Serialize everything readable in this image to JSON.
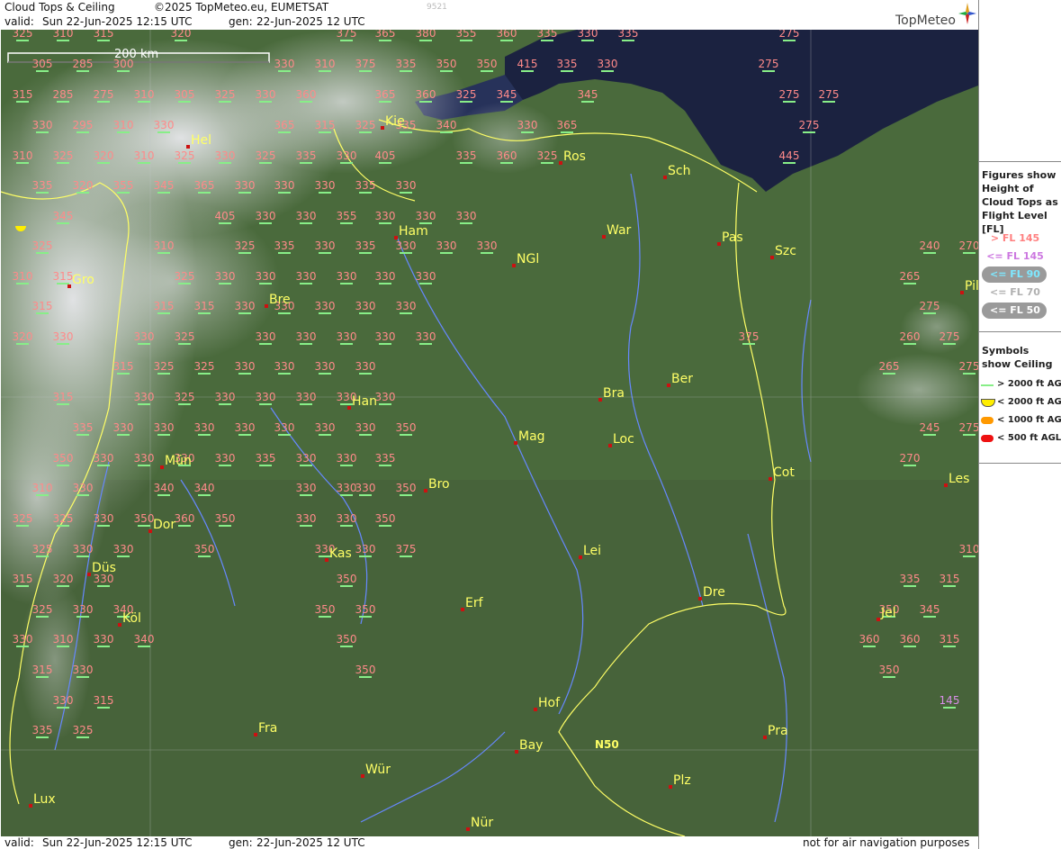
{
  "header": {
    "title": "Cloud Tops & Ceiling",
    "copyright": "©2025 TopMeteo.eu, EUMETSAT",
    "valid_label": "valid:",
    "valid_time": "Sun  22-Jun-2025  12:15 UTC",
    "gen_label": "gen:",
    "gen_time": "22-Jun-2025 12 UTC",
    "code": "9521",
    "logo_text": "TopMeteo"
  },
  "footer": {
    "valid_label": "valid:",
    "valid_time": "Sun  22-Jun-2025  12:15 UTC",
    "gen_label": "gen:",
    "gen_time": "22-Jun-2025 12 UTC",
    "disclaimer": "not for air navigation purposes"
  },
  "map": {
    "scale_label": "200 km",
    "grid_label": "N50",
    "colors": {
      "tops_high": "#ff8a8a",
      "tops_mid": "#d88ee8",
      "tops_low": "#7ee8ff",
      "city": "#ffff66",
      "city_marker": "#cc1111",
      "ceiling_gt2000": "#88ee88",
      "ceiling_lt2000": "#ffee00",
      "sea": "#1b2240",
      "land": "#4a6a3c",
      "border": "#ffff66",
      "river": "#6688ff"
    },
    "cities": [
      {
        "name": "Hel"
      },
      {
        "name": "Kie"
      },
      {
        "name": "Ros"
      },
      {
        "name": "Sch"
      },
      {
        "name": "Ham"
      },
      {
        "name": "War"
      },
      {
        "name": "Pas"
      },
      {
        "name": "Szc"
      },
      {
        "name": "NGl"
      },
      {
        "name": "Gro"
      },
      {
        "name": "Bre"
      },
      {
        "name": "Pil"
      },
      {
        "name": "Ber"
      },
      {
        "name": "Bra"
      },
      {
        "name": "Han"
      },
      {
        "name": "Mag"
      },
      {
        "name": "Loc"
      },
      {
        "name": "Mün"
      },
      {
        "name": "Cot"
      },
      {
        "name": "Les"
      },
      {
        "name": "Bro"
      },
      {
        "name": "Dor"
      },
      {
        "name": "Kas"
      },
      {
        "name": "Lei"
      },
      {
        "name": "Düs"
      },
      {
        "name": "Dre"
      },
      {
        "name": "Erf"
      },
      {
        "name": "Köl"
      },
      {
        "name": "Jel"
      },
      {
        "name": "Hof"
      },
      {
        "name": "Fra"
      },
      {
        "name": "Pra"
      },
      {
        "name": "Bay"
      },
      {
        "name": "Wür"
      },
      {
        "name": "Plz"
      },
      {
        "name": "Lux"
      },
      {
        "name": "Nür"
      }
    ],
    "tops": [
      {
        "v": "325",
        "c": "high"
      },
      {
        "v": "310",
        "c": "high"
      },
      {
        "v": "315",
        "c": "high"
      },
      {
        "v": "320",
        "c": "high"
      },
      {
        "v": "375",
        "c": "high"
      },
      {
        "v": "365",
        "c": "high"
      },
      {
        "v": "380",
        "c": "high"
      },
      {
        "v": "355",
        "c": "high"
      },
      {
        "v": "360",
        "c": "high"
      },
      {
        "v": "335",
        "c": "high"
      },
      {
        "v": "330",
        "c": "high"
      },
      {
        "v": "335",
        "c": "high"
      },
      {
        "v": "275",
        "c": "high"
      },
      {
        "v": "305",
        "c": "high"
      },
      {
        "v": "285",
        "c": "high"
      },
      {
        "v": "300",
        "c": "high"
      },
      {
        "v": "330",
        "c": "high"
      },
      {
        "v": "310",
        "c": "high"
      },
      {
        "v": "375",
        "c": "high"
      },
      {
        "v": "335",
        "c": "high"
      },
      {
        "v": "350",
        "c": "high"
      },
      {
        "v": "350",
        "c": "high"
      },
      {
        "v": "415",
        "c": "high"
      },
      {
        "v": "335",
        "c": "high"
      },
      {
        "v": "330",
        "c": "high"
      },
      {
        "v": "275",
        "c": "high"
      },
      {
        "v": "315",
        "c": "high"
      },
      {
        "v": "285",
        "c": "high"
      },
      {
        "v": "275",
        "c": "high"
      },
      {
        "v": "310",
        "c": "high"
      },
      {
        "v": "305",
        "c": "high"
      },
      {
        "v": "325",
        "c": "high"
      },
      {
        "v": "330",
        "c": "high"
      },
      {
        "v": "360",
        "c": "high"
      },
      {
        "v": "365",
        "c": "high"
      },
      {
        "v": "360",
        "c": "high"
      },
      {
        "v": "325",
        "c": "high"
      },
      {
        "v": "345",
        "c": "high"
      },
      {
        "v": "345",
        "c": "high"
      },
      {
        "v": "275",
        "c": "high"
      },
      {
        "v": "275",
        "c": "high"
      },
      {
        "v": "330",
        "c": "high"
      },
      {
        "v": "295",
        "c": "high"
      },
      {
        "v": "310",
        "c": "high"
      },
      {
        "v": "330",
        "c": "high"
      },
      {
        "v": "365",
        "c": "high"
      },
      {
        "v": "315",
        "c": "high"
      },
      {
        "v": "325",
        "c": "high"
      },
      {
        "v": "335",
        "c": "high"
      },
      {
        "v": "340",
        "c": "high"
      },
      {
        "v": "330",
        "c": "high"
      },
      {
        "v": "365",
        "c": "high"
      },
      {
        "v": "275",
        "c": "high"
      },
      {
        "v": "310",
        "c": "high"
      },
      {
        "v": "325",
        "c": "high"
      },
      {
        "v": "320",
        "c": "high"
      },
      {
        "v": "310",
        "c": "high"
      },
      {
        "v": "325",
        "c": "high"
      },
      {
        "v": "330",
        "c": "high"
      },
      {
        "v": "325",
        "c": "high"
      },
      {
        "v": "335",
        "c": "high"
      },
      {
        "v": "330",
        "c": "high"
      },
      {
        "v": "405",
        "c": "high"
      },
      {
        "v": "335",
        "c": "high"
      },
      {
        "v": "360",
        "c": "high"
      },
      {
        "v": "325",
        "c": "high"
      },
      {
        "v": "445",
        "c": "high"
      },
      {
        "v": "335",
        "c": "high"
      },
      {
        "v": "320",
        "c": "high"
      },
      {
        "v": "355",
        "c": "high"
      },
      {
        "v": "345",
        "c": "high"
      },
      {
        "v": "365",
        "c": "high"
      },
      {
        "v": "330",
        "c": "high"
      },
      {
        "v": "330",
        "c": "high"
      },
      {
        "v": "330",
        "c": "high"
      },
      {
        "v": "335",
        "c": "high"
      },
      {
        "v": "330",
        "c": "high"
      },
      {
        "v": "345",
        "c": "high"
      },
      {
        "v": "405",
        "c": "high"
      },
      {
        "v": "330",
        "c": "high"
      },
      {
        "v": "330",
        "c": "high"
      },
      {
        "v": "355",
        "c": "high"
      },
      {
        "v": "330",
        "c": "high"
      },
      {
        "v": "330",
        "c": "high"
      },
      {
        "v": "330",
        "c": "high"
      },
      {
        "v": "325",
        "c": "high"
      },
      {
        "v": "310",
        "c": "high"
      },
      {
        "v": "325",
        "c": "high"
      },
      {
        "v": "335",
        "c": "high"
      },
      {
        "v": "330",
        "c": "high"
      },
      {
        "v": "335",
        "c": "high"
      },
      {
        "v": "330",
        "c": "high"
      },
      {
        "v": "330",
        "c": "high"
      },
      {
        "v": "330",
        "c": "high"
      },
      {
        "v": "240",
        "c": "high"
      },
      {
        "v": "270",
        "c": "high"
      },
      {
        "v": "310",
        "c": "high"
      },
      {
        "v": "315",
        "c": "high"
      },
      {
        "v": "325",
        "c": "high"
      },
      {
        "v": "330",
        "c": "high"
      },
      {
        "v": "330",
        "c": "high"
      },
      {
        "v": "330",
        "c": "high"
      },
      {
        "v": "330",
        "c": "high"
      },
      {
        "v": "330",
        "c": "high"
      },
      {
        "v": "330",
        "c": "high"
      },
      {
        "v": "265",
        "c": "high"
      },
      {
        "v": "315",
        "c": "high"
      },
      {
        "v": "315",
        "c": "high"
      },
      {
        "v": "315",
        "c": "high"
      },
      {
        "v": "330",
        "c": "high"
      },
      {
        "v": "330",
        "c": "high"
      },
      {
        "v": "330",
        "c": "high"
      },
      {
        "v": "330",
        "c": "high"
      },
      {
        "v": "330",
        "c": "high"
      },
      {
        "v": "275",
        "c": "high"
      },
      {
        "v": "320",
        "c": "high"
      },
      {
        "v": "330",
        "c": "high"
      },
      {
        "v": "330",
        "c": "high"
      },
      {
        "v": "325",
        "c": "high"
      },
      {
        "v": "330",
        "c": "high"
      },
      {
        "v": "330",
        "c": "high"
      },
      {
        "v": "330",
        "c": "high"
      },
      {
        "v": "330",
        "c": "high"
      },
      {
        "v": "330",
        "c": "high"
      },
      {
        "v": "375",
        "c": "high"
      },
      {
        "v": "260",
        "c": "high"
      },
      {
        "v": "275",
        "c": "high"
      },
      {
        "v": "315",
        "c": "high"
      },
      {
        "v": "325",
        "c": "high"
      },
      {
        "v": "325",
        "c": "high"
      },
      {
        "v": "330",
        "c": "high"
      },
      {
        "v": "330",
        "c": "high"
      },
      {
        "v": "330",
        "c": "high"
      },
      {
        "v": "330",
        "c": "high"
      },
      {
        "v": "265",
        "c": "high"
      },
      {
        "v": "275",
        "c": "high"
      },
      {
        "v": "315",
        "c": "high"
      },
      {
        "v": "330",
        "c": "high"
      },
      {
        "v": "325",
        "c": "high"
      },
      {
        "v": "330",
        "c": "high"
      },
      {
        "v": "330",
        "c": "high"
      },
      {
        "v": "330",
        "c": "high"
      },
      {
        "v": "330",
        "c": "high"
      },
      {
        "v": "330",
        "c": "high"
      },
      {
        "v": "335",
        "c": "high"
      },
      {
        "v": "330",
        "c": "high"
      },
      {
        "v": "330",
        "c": "high"
      },
      {
        "v": "330",
        "c": "high"
      },
      {
        "v": "330",
        "c": "high"
      },
      {
        "v": "330",
        "c": "high"
      },
      {
        "v": "330",
        "c": "high"
      },
      {
        "v": "330",
        "c": "high"
      },
      {
        "v": "350",
        "c": "high"
      },
      {
        "v": "245",
        "c": "high"
      },
      {
        "v": "275",
        "c": "high"
      },
      {
        "v": "350",
        "c": "high"
      },
      {
        "v": "330",
        "c": "high"
      },
      {
        "v": "330",
        "c": "high"
      },
      {
        "v": "330",
        "c": "high"
      },
      {
        "v": "330",
        "c": "high"
      },
      {
        "v": "335",
        "c": "high"
      },
      {
        "v": "330",
        "c": "high"
      },
      {
        "v": "330",
        "c": "high"
      },
      {
        "v": "335",
        "c": "high"
      },
      {
        "v": "270",
        "c": "high"
      },
      {
        "v": "310",
        "c": "high"
      },
      {
        "v": "330",
        "c": "high"
      },
      {
        "v": "340",
        "c": "high"
      },
      {
        "v": "340",
        "c": "high"
      },
      {
        "v": "330",
        "c": "high"
      },
      {
        "v": "330",
        "c": "high"
      },
      {
        "v": "330",
        "c": "high"
      },
      {
        "v": "350",
        "c": "high"
      },
      {
        "v": "325",
        "c": "high"
      },
      {
        "v": "325",
        "c": "high"
      },
      {
        "v": "330",
        "c": "high"
      },
      {
        "v": "350",
        "c": "high"
      },
      {
        "v": "360",
        "c": "high"
      },
      {
        "v": "350",
        "c": "high"
      },
      {
        "v": "330",
        "c": "high"
      },
      {
        "v": "330",
        "c": "high"
      },
      {
        "v": "350",
        "c": "high"
      },
      {
        "v": "325",
        "c": "high"
      },
      {
        "v": "330",
        "c": "high"
      },
      {
        "v": "330",
        "c": "high"
      },
      {
        "v": "350",
        "c": "high"
      },
      {
        "v": "330",
        "c": "high"
      },
      {
        "v": "330",
        "c": "high"
      },
      {
        "v": "375",
        "c": "high"
      },
      {
        "v": "310",
        "c": "high"
      },
      {
        "v": "315",
        "c": "high"
      },
      {
        "v": "320",
        "c": "high"
      },
      {
        "v": "330",
        "c": "high"
      },
      {
        "v": "350",
        "c": "high"
      },
      {
        "v": "335",
        "c": "high"
      },
      {
        "v": "315",
        "c": "high"
      },
      {
        "v": "325",
        "c": "high"
      },
      {
        "v": "330",
        "c": "high"
      },
      {
        "v": "340",
        "c": "high"
      },
      {
        "v": "350",
        "c": "high"
      },
      {
        "v": "350",
        "c": "high"
      },
      {
        "v": "350",
        "c": "high"
      },
      {
        "v": "345",
        "c": "high"
      },
      {
        "v": "330",
        "c": "high"
      },
      {
        "v": "310",
        "c": "high"
      },
      {
        "v": "330",
        "c": "high"
      },
      {
        "v": "340",
        "c": "high"
      },
      {
        "v": "350",
        "c": "high"
      },
      {
        "v": "360",
        "c": "high"
      },
      {
        "v": "360",
        "c": "high"
      },
      {
        "v": "315",
        "c": "high"
      },
      {
        "v": "315",
        "c": "high"
      },
      {
        "v": "330",
        "c": "high"
      },
      {
        "v": "350",
        "c": "high"
      },
      {
        "v": "350",
        "c": "high"
      },
      {
        "v": "330",
        "c": "high"
      },
      {
        "v": "315",
        "c": "high"
      },
      {
        "v": "145",
        "c": "mid"
      },
      {
        "v": "335",
        "c": "high"
      },
      {
        "v": "325",
        "c": "high"
      }
    ]
  },
  "legend": {
    "tops_title": "Figures show Height of Cloud Tops as Flight Level  [FL]",
    "tops_items": [
      {
        "label": "> FL 145",
        "color": "#ff7f7f",
        "pill": false
      },
      {
        "label": "<= FL 145",
        "color": "#cc77e0",
        "pill": false
      },
      {
        "label": "<= FL 90",
        "color": "#7ee8ff",
        "pill": true
      },
      {
        "label": "<= FL 70",
        "color": "#b0b0b0",
        "pill": false
      },
      {
        "label": "<= FL 50",
        "color": "#ffffff",
        "pill": true
      }
    ],
    "ceiling_title": "Symbols show Ceiling",
    "ceiling_items": [
      {
        "label": "> 2000 ft AGL",
        "color": "#88ee88",
        "shape": "line"
      },
      {
        "label": "< 2000 ft AGL",
        "color": "#ffee00",
        "shape": "half-disc"
      },
      {
        "label": "< 1000 ft AGL",
        "color": "#ff9900",
        "shape": "pill"
      },
      {
        "label": "< 500 ft AGL",
        "color": "#ee1111",
        "shape": "pill"
      }
    ]
  }
}
